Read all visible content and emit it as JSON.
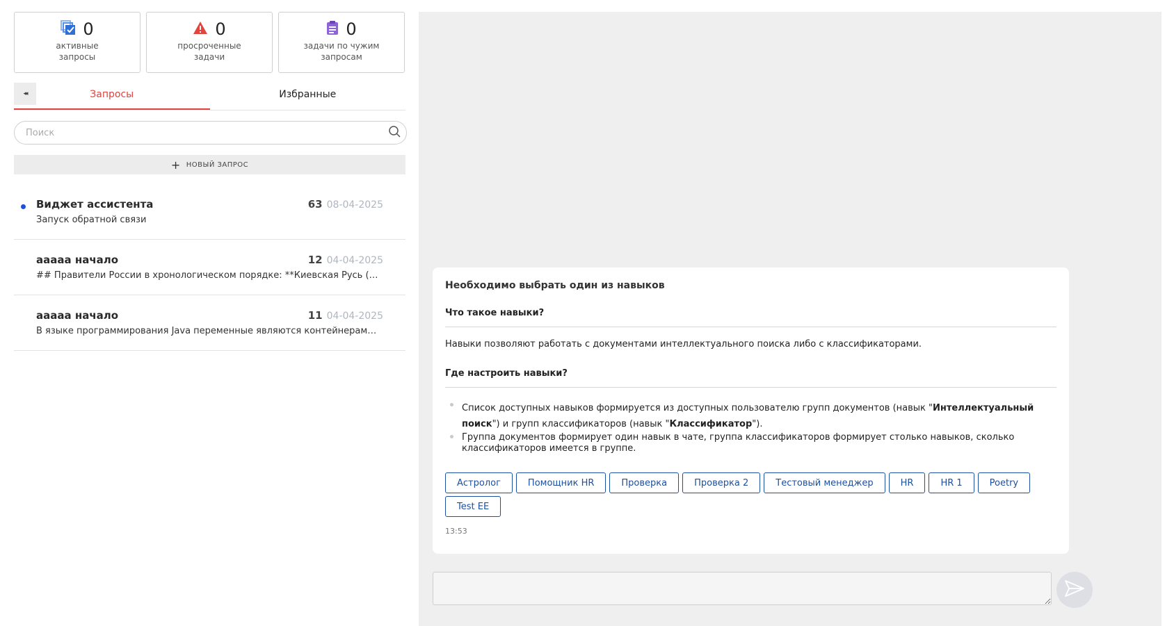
{
  "stats": [
    {
      "icon": "active-requests-icon",
      "count": "0",
      "label_line1": "активные",
      "label_line2": "запросы",
      "color": "#2f6fd6"
    },
    {
      "icon": "warning-icon",
      "count": "0",
      "label_line1": "просроченные",
      "label_line2": "задачи",
      "color": "#e2453c"
    },
    {
      "icon": "clipboard-icon",
      "count": "0",
      "label_line1": "задачи по чужим",
      "label_line2": "запросам",
      "color": "#8e63d8"
    }
  ],
  "tabs": {
    "collapse_icon": "collapse-left-icon",
    "requests": "Запросы",
    "favorites": "Избранные"
  },
  "search": {
    "placeholder": "Поиск"
  },
  "new_request": {
    "label": "НОВЫЙ ЗАПРОС"
  },
  "requests": [
    {
      "title": "Виджет ассистента",
      "count": "63",
      "date": "08-04-2025",
      "subtitle": "Запуск обратной связи",
      "unread": true
    },
    {
      "title": "ааааа начало",
      "count": "12",
      "date": "04-04-2025",
      "subtitle": "## Правители России в хронологическом порядке: **Киевская Русь (д...",
      "unread": false
    },
    {
      "title": "ааааа начало",
      "count": "11",
      "date": "04-04-2025",
      "subtitle": "В языке программирования Java переменные являются контейнерами ...",
      "unread": false
    }
  ],
  "message": {
    "title": "Необходимо выбрать один из навыков",
    "q1": "Что такое навыки?",
    "a1": "Навыки позволяют работать с документами интеллектуального поиска либо с классификаторами.",
    "q2": "Где настроить навыки?",
    "b1_part1": "Список доступных навыков формируется из доступных пользователю групп документов (навык \"",
    "b1_bold1": "Интеллектуальный поиск",
    "b1_part2": "\") и групп классификаторов (навык \"",
    "b1_bold2": "Классификатор",
    "b1_part3": "\").",
    "b2": "Группа документов формирует один навык в чате, группа классификаторов формирует столько навыков, сколько классификаторов имеется в группе.",
    "skills": [
      "Астролог",
      "Помощник HR",
      "Проверка",
      "Проверка 2",
      "Тестовый менеджер",
      "HR",
      "HR 1",
      "Poetry",
      "Test EE"
    ],
    "time": "13:53"
  },
  "composer": {
    "value": "",
    "send_icon": "send-icon"
  }
}
